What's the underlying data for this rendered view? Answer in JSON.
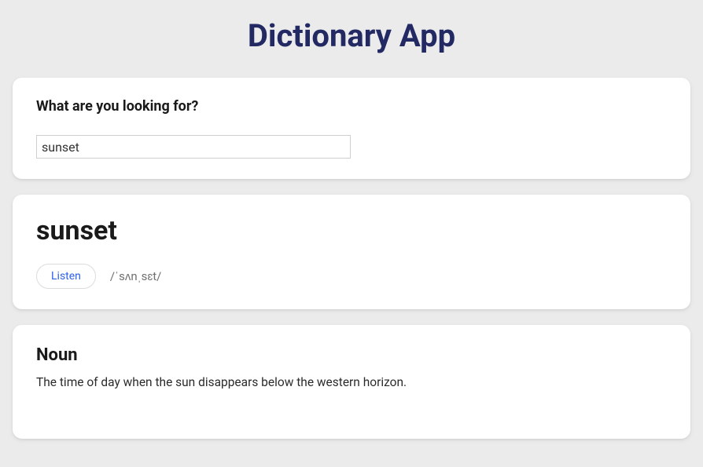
{
  "header": {
    "title": "Dictionary App"
  },
  "search": {
    "label": "What are you looking for?",
    "value": "sunset"
  },
  "result": {
    "word": "sunset",
    "listen_label": "Listen",
    "phonetic": "/ˈsʌnˌsɛt/"
  },
  "meaning": {
    "part_of_speech": "Noun",
    "definition": "The time of day when the sun disappears below the western horizon."
  }
}
